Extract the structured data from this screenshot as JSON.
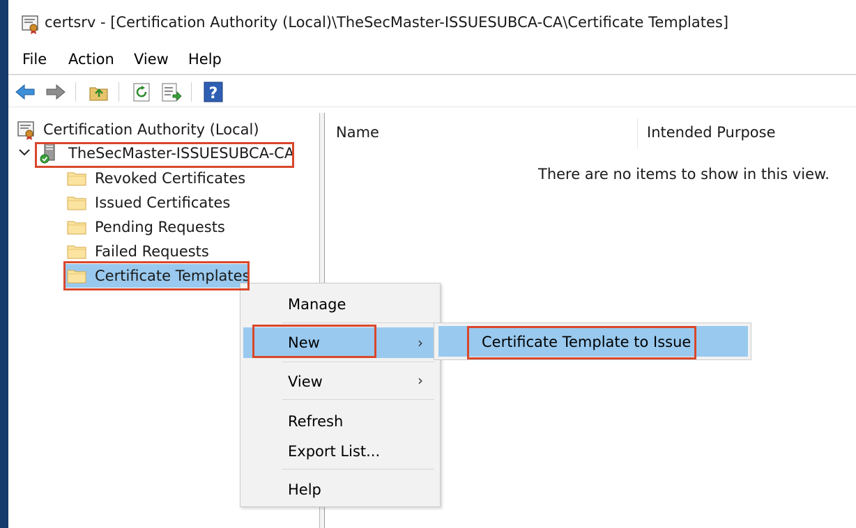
{
  "window": {
    "title": "certsrv - [Certification Authority (Local)\\TheSecMaster-ISSUESUBCA-CA\\Certificate Templates]"
  },
  "menubar": {
    "items": [
      "File",
      "Action",
      "View",
      "Help"
    ]
  },
  "toolbar": {
    "icons": [
      "back-arrow-icon",
      "forward-arrow-icon",
      "up-folder-icon",
      "refresh-icon",
      "export-list-icon",
      "help-icon"
    ]
  },
  "tree": {
    "root": "Certification Authority (Local)",
    "ca": "TheSecMaster-ISSUESUBCA-CA",
    "children": [
      "Revoked Certificates",
      "Issued Certificates",
      "Pending Requests",
      "Failed Requests",
      "Certificate Templates"
    ]
  },
  "list": {
    "columns": [
      "Name",
      "Intended Purpose"
    ],
    "empty_message": "There are no items to show in this view."
  },
  "context_menu": {
    "items": [
      "Manage",
      "New",
      "View",
      "Refresh",
      "Export List...",
      "Help"
    ],
    "highlighted": "New"
  },
  "submenu": {
    "item": "Certificate Template to Issue"
  },
  "colors": {
    "highlight": "#99c9ef",
    "annotation_red": "#d9472b",
    "desktop": "#163a6b"
  }
}
